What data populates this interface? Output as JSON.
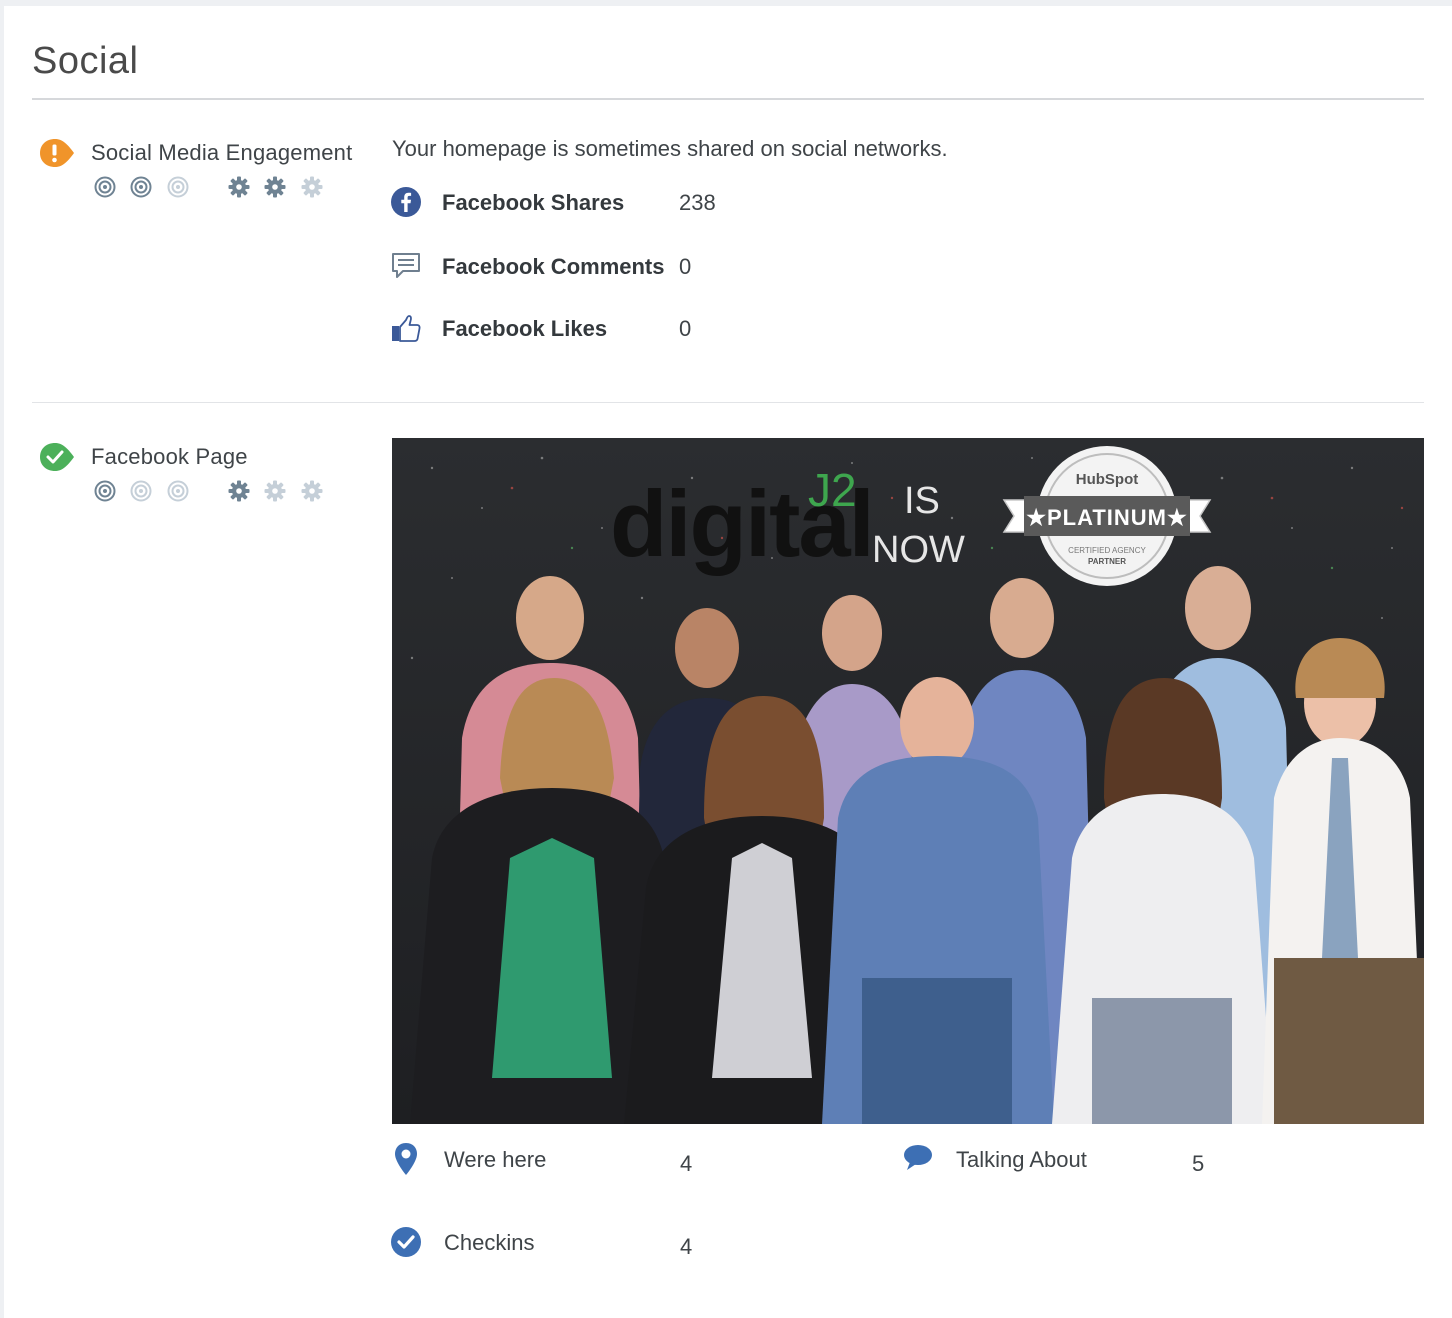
{
  "section": {
    "title": "Social"
  },
  "social_media_engagement": {
    "label": "Social Media Engagement",
    "status": "warning",
    "status_icon": "warning-icon",
    "status_color": "#f0942a",
    "summary": "Your homepage is sometimes shared on social networks.",
    "importance_rating": 2,
    "difficulty_rating": 2,
    "stats": [
      {
        "icon": "facebook-icon",
        "label": "Facebook Shares",
        "value": "238"
      },
      {
        "icon": "comments-icon",
        "label": "Facebook Comments",
        "value": "0"
      },
      {
        "icon": "thumbs-up-icon",
        "label": "Facebook Likes",
        "value": "0"
      }
    ]
  },
  "facebook_page": {
    "label": "Facebook Page",
    "status": "pass",
    "status_icon": "check-icon",
    "status_color": "#4cb05a",
    "importance_rating": 1,
    "difficulty_rating": 1,
    "cover_photo": {
      "brand_text": "digital",
      "brand_superscript": "J2",
      "headline_line1": "IS",
      "headline_line2": "NOW",
      "badge_top": "HubSpot",
      "badge_main": "PLATINUM",
      "badge_sub1": "CERTIFIED AGENCY",
      "badge_sub2": "PARTNER"
    },
    "stats": [
      {
        "icon": "map-pin-icon",
        "label": "Were here",
        "value": "4"
      },
      {
        "icon": "speech-bubble-icon",
        "label": "Talking About",
        "value": "5"
      },
      {
        "icon": "checkmark-circle-icon",
        "label": "Checkins",
        "value": "4"
      }
    ]
  },
  "colors": {
    "icon_blue": "#3d6fb4",
    "rating_active": "#6f8393",
    "rating_inactive": "#c5cfd8",
    "facebook_blue": "#3b5998"
  }
}
